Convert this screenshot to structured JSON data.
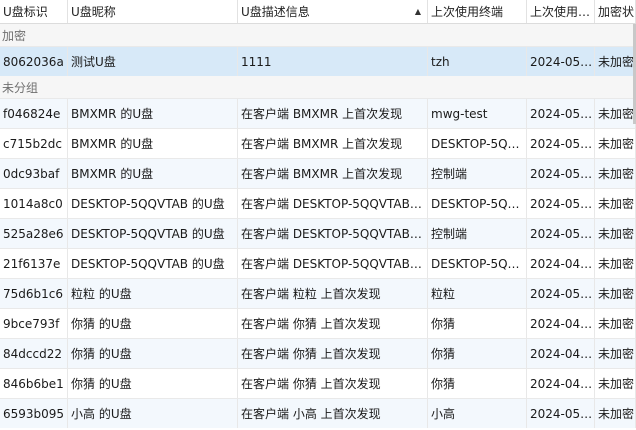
{
  "table": {
    "columns": [
      "U盘标识",
      "U盘昵称",
      "U盘描述信息",
      "上次使用终端",
      "上次使用…",
      "加密状"
    ],
    "sort_indicator": "▲",
    "groups": [
      {
        "label": "加密",
        "rows": [
          [
            "8062036a",
            "测试U盘",
            "1111",
            "tzh",
            "2024-05…",
            "未加密"
          ]
        ]
      },
      {
        "label": "未分组",
        "rows": [
          [
            "f046824e",
            "BMXMR 的U盘",
            "在客户端 BMXMR 上首次发现",
            "mwg-test",
            "2024-05…",
            "未加密"
          ],
          [
            "c715b2dc",
            "BMXMR 的U盘",
            "在客户端 BMXMR 上首次发现",
            "DESKTOP-5Q…",
            "2024-05…",
            "未加密"
          ],
          [
            "0dc93baf",
            "BMXMR 的U盘",
            "在客户端 BMXMR 上首次发现",
            "控制端",
            "2024-05…",
            "未加密"
          ],
          [
            "1014a8c0",
            "DESKTOP-5QQVTAB 的U盘",
            "在客户端 DESKTOP-5QQVTAB…",
            "DESKTOP-5Q…",
            "2024-05…",
            "未加密"
          ],
          [
            "525a28e6",
            "DESKTOP-5QQVTAB 的U盘",
            "在客户端 DESKTOP-5QQVTAB…",
            "控制端",
            "2024-05…",
            "未加密"
          ],
          [
            "21f6137e",
            "DESKTOP-5QQVTAB 的U盘",
            "在客户端 DESKTOP-5QQVTAB…",
            "DESKTOP-5Q…",
            "2024-04…",
            "未加密"
          ],
          [
            "75d6b1c6",
            "粒粒 的U盘",
            "在客户端 粒粒 上首次发现",
            "粒粒",
            "2024-05…",
            "未加密"
          ],
          [
            "9bce793f",
            "你猜 的U盘",
            "在客户端 你猜 上首次发现",
            "你猜",
            "2024-04…",
            "未加密"
          ],
          [
            "84dccd22",
            "你猜 的U盘",
            "在客户端 你猜 上首次发现",
            "你猜",
            "2024-04…",
            "未加密"
          ],
          [
            "846b6be1",
            "你猜 的U盘",
            "在客户端 你猜 上首次发现",
            "你猜",
            "2024-04…",
            "未加密"
          ],
          [
            "6593b095",
            "小高 的U盘",
            "在客户端 小高 上首次发现",
            "小高",
            "2024-05…",
            "未加密"
          ]
        ]
      }
    ]
  },
  "colors": {
    "selected_row": "#d7e9f8",
    "striped_row": "#f3f8fd",
    "group_header": "#f6f6f6"
  }
}
